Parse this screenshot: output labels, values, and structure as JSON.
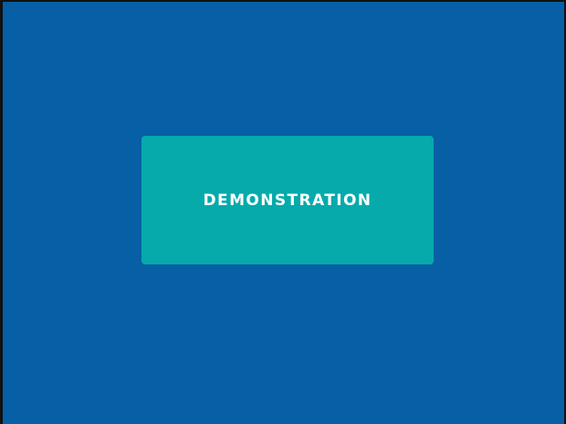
{
  "slide": {
    "background_color": "#075fa5",
    "card": {
      "label": "DEMONSTRATION",
      "background_color": "#06aaab",
      "text_color": "#ffffff"
    }
  }
}
